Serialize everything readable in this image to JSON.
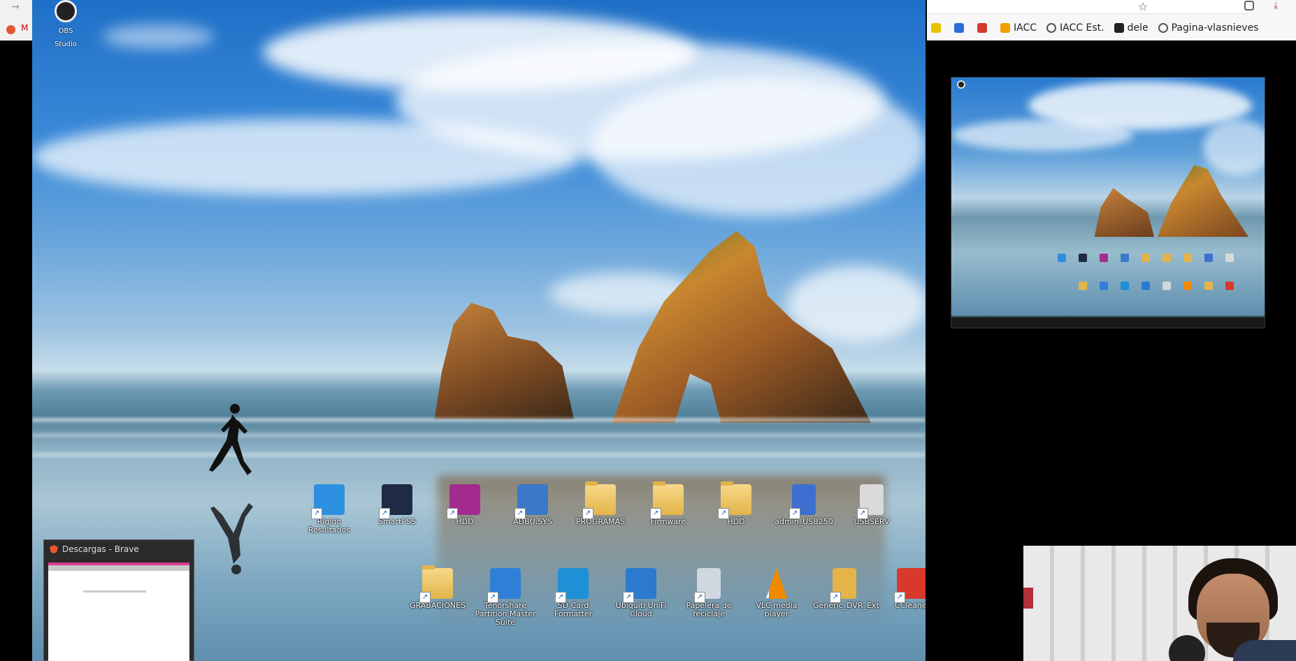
{
  "left_browser": {
    "partial_label": "M"
  },
  "right_browser": {
    "bookmarks": [
      {
        "label": "",
        "icon": "yellow-favicon",
        "color": "#e5c100"
      },
      {
        "label": "",
        "icon": "blue-c-favicon",
        "color": "#2a6dd8"
      },
      {
        "label": "",
        "icon": "red-favicon",
        "color": "#d43a2a"
      },
      {
        "label": "IACC",
        "icon": "iacc-favicon",
        "color": "#f0a000"
      },
      {
        "label": "IACC Est.",
        "icon": "globe-icon",
        "color": "#555555"
      },
      {
        "label": "dele",
        "icon": "black-favicon",
        "color": "#222222"
      },
      {
        "label": "Pagina-vlasnieves",
        "icon": "globe-icon",
        "color": "#555555"
      }
    ]
  },
  "desktop": {
    "obs_icon_label": "OBS Studio",
    "icons_row1": [
      {
        "label": "Rígido Resultados",
        "icon": "blue-square-app-icon",
        "color": "#2d8fe0"
      },
      {
        "label": "SmartPSS",
        "icon": "camera-app-icon",
        "color": "#1f2a44"
      },
      {
        "label": "HDD",
        "icon": "winrar-icon",
        "color": "#a32a8f"
      },
      {
        "label": "ADBU.SYS",
        "icon": "usb-shortcut-icon",
        "color": "#3b78c8"
      },
      {
        "label": "PROGRAMAS",
        "icon": "folder-icon",
        "color": "#e4b449"
      },
      {
        "label": "Firmware",
        "icon": "folder-icon",
        "color": "#e4b449"
      },
      {
        "label": "HDD",
        "icon": "folder-icon",
        "color": "#e4b449"
      },
      {
        "label": "admin_USB250",
        "icon": "document-icon",
        "color": "#3c6fd0"
      },
      {
        "label": "USBSERV",
        "icon": "disc-file-icon",
        "color": "#d9d9d9"
      }
    ],
    "icons_row2": [
      {
        "label": "GRABACIONES",
        "icon": "folder-icon",
        "color": "#e4b449"
      },
      {
        "label": "Tenorshare Partition Master Suite",
        "icon": "partition-app-icon",
        "color": "#2f7fd6"
      },
      {
        "label": "SD Card Formatter",
        "icon": "sd-card-icon",
        "color": "#1e90d6"
      },
      {
        "label": "Ubiquiti UniFi Cloud",
        "icon": "cloud-app-icon",
        "color": "#2b7ad0"
      },
      {
        "label": "Papelera de reciclaje",
        "icon": "recycle-bin-icon",
        "color": "#cfd8e0"
      },
      {
        "label": "VLC media player",
        "icon": "vlc-cone-icon",
        "color": "#f08a00"
      },
      {
        "label": "Generic_DVR_Ext",
        "icon": "document-icon",
        "color": "#e4b449"
      },
      {
        "label": "CCleaner",
        "icon": "ccleaner-icon",
        "color": "#d9382c"
      }
    ]
  },
  "thumbnail_window": {
    "title": "Descargas - Brave"
  }
}
